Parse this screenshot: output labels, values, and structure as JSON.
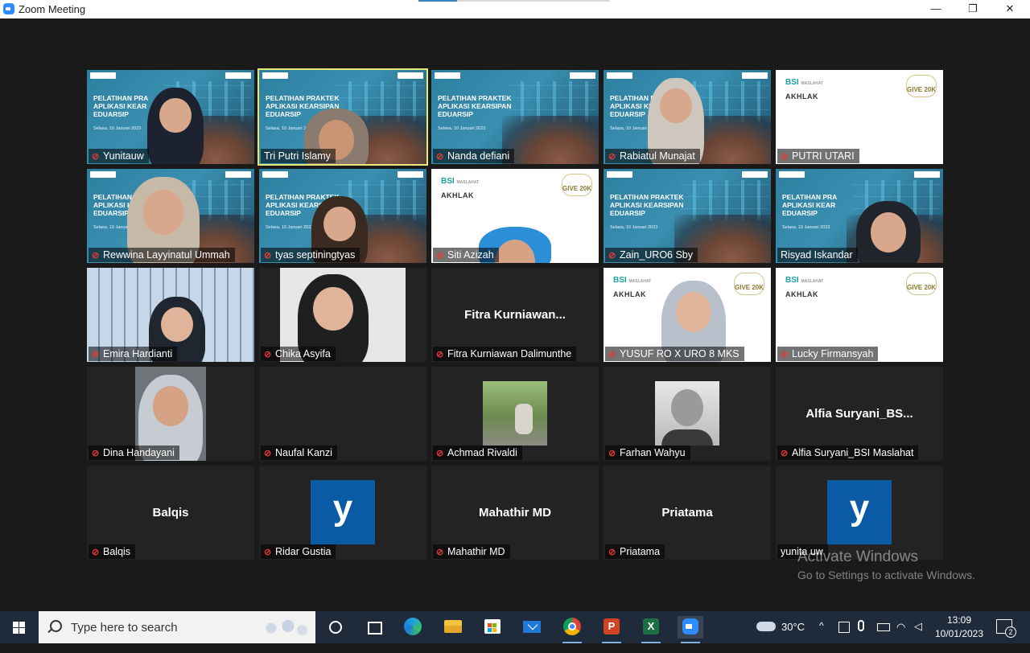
{
  "window": {
    "title": "Zoom Meeting",
    "minimize_label": "—",
    "restore_label": "❐",
    "close_label": "✕"
  },
  "participants": [
    {
      "name": "Yunitauw",
      "view": "slide-cam",
      "muted": true
    },
    {
      "name": "Tri Putri Islamy",
      "view": "slide-cam",
      "muted": false,
      "active_speaker": true
    },
    {
      "name": "Nanda defiani",
      "view": "slide",
      "muted": true
    },
    {
      "name": "Rabiatul Munajat",
      "view": "slide-cam",
      "muted": true
    },
    {
      "name": "PUTRI UTARI",
      "view": "bsi",
      "muted": true
    },
    {
      "name": "Rewwina Layyinatul Ummah",
      "view": "slide-cam",
      "muted": true
    },
    {
      "name": "tyas septiningtyas",
      "view": "slide-cam",
      "muted": true
    },
    {
      "name": "Siti Azizah",
      "view": "bsi-cam",
      "muted": true
    },
    {
      "name": "Zain_URO6 Sby",
      "view": "slide",
      "muted": true
    },
    {
      "name": "Risyad Iskandar",
      "view": "slide-cam",
      "muted": false
    },
    {
      "name": "Emira Hardianti",
      "view": "camera",
      "muted": true
    },
    {
      "name": "Chika Asyifa",
      "view": "camera",
      "muted": true
    },
    {
      "name": "Fitra Kurniawan Dalimunthe",
      "view": "name",
      "display": "Fitra  Kurniawan...",
      "muted": true
    },
    {
      "name": "YUSUF RO X URO 8 MKS",
      "view": "bsi-cam",
      "muted": true
    },
    {
      "name": "Lucky Firmansyah",
      "view": "bsi",
      "muted": true
    },
    {
      "name": "Dina Handayani",
      "view": "camera",
      "muted": true
    },
    {
      "name": "Naufal Kanzi",
      "view": "blank",
      "muted": true
    },
    {
      "name": "Achmad Rivaldi",
      "view": "photo",
      "muted": true
    },
    {
      "name": "Farhan Wahyu",
      "view": "photo",
      "muted": true
    },
    {
      "name": "Alfia Suryani_BSI Maslahat",
      "view": "name",
      "display": "Alfia  Suryani_BS...",
      "muted": true
    },
    {
      "name": "Balqis",
      "view": "name",
      "display": "Balqis",
      "muted": true
    },
    {
      "name": "Ridar Gustia",
      "view": "avatar-y",
      "muted": true
    },
    {
      "name": "Mahathir MD",
      "view": "name",
      "display": "Mahathir MD",
      "muted": true
    },
    {
      "name": "Priatama",
      "view": "name",
      "display": "Priatama",
      "muted": true
    },
    {
      "name": "yunita uw",
      "view": "avatar-y",
      "muted": false
    }
  ],
  "slide": {
    "title_lines": [
      "PELATIHAN PRAKTEK",
      "APLIKASI KEARSIPAN",
      "EDUARSIP"
    ],
    "date": "Selasa, 10 Januari 2023",
    "truncated_title_lines": [
      "PELATIHAN PRA",
      "APLIKASI KEAR",
      "EDUARSIP"
    ]
  },
  "bsi_slide": {
    "brand": "BSI",
    "sub": "MASLAHAT",
    "akhlak": "AKHLAK",
    "badge": "GIVE 20K"
  },
  "avatar_letter": "y",
  "watermark": {
    "line1": "Activate Windows",
    "line2": "Go to Settings to activate Windows."
  },
  "taskbar": {
    "search_placeholder": "Type here to search",
    "apps": [
      "cortana-icon",
      "task-view-icon",
      "edge-icon",
      "file-explorer-icon",
      "store-icon",
      "mail-icon",
      "chrome-icon",
      "powerpoint-icon",
      "excel-icon",
      "zoom-icon"
    ],
    "weather": "30°C",
    "time": "13:09",
    "date": "10/01/2023",
    "notifications": "2"
  }
}
